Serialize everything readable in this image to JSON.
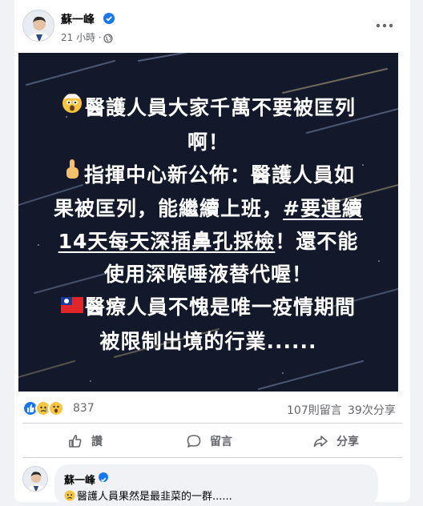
{
  "post": {
    "author": "蘇一峰",
    "timestamp": "21 小時 ·",
    "lines": [
      {
        "emoji": "astonished-face",
        "text": "醫護人員大家千萬不要被匡列"
      },
      {
        "text": "啊！"
      },
      {
        "emoji": "point-up",
        "text": "指揮中心新公佈：醫護人員如"
      },
      {
        "text_before": "果被匡列，能繼續上班，",
        "underlined": "#要連續"
      },
      {
        "underlined": "14天每天深插鼻孔採檢",
        "text_after": "！還不能"
      },
      {
        "text": "使用深喉唾液替代喔！"
      },
      {
        "emoji": "taiwan-flag",
        "text": "醫療人員不愧是唯一疫情期間"
      },
      {
        "text": "被限制出境的行業......"
      }
    ]
  },
  "stats": {
    "reaction_count": "837",
    "comments": "107則留言",
    "shares": "39次分享",
    "reaction_icons": [
      "like-icon",
      "sad-icon",
      "wow-icon"
    ]
  },
  "actions": {
    "like": "讚",
    "comment": "留言",
    "share": "分享"
  },
  "comment": {
    "author": "蘇一峰",
    "text": "醫護人員果然是最韭菜的一群......"
  },
  "colors": {
    "brand_blue": "#1877f2",
    "secondary_text": "#65676b",
    "image_bg": "#13192a"
  }
}
